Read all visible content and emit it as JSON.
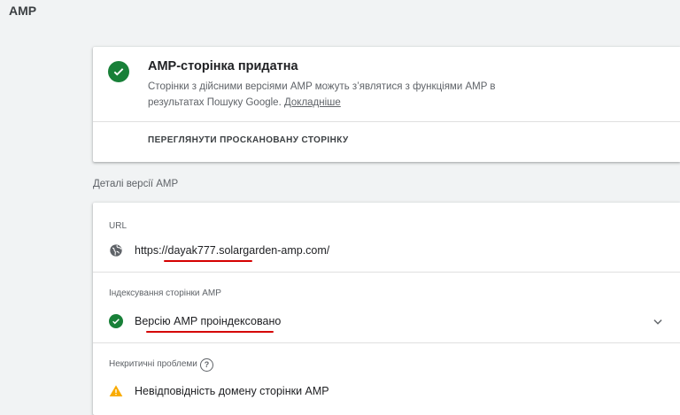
{
  "page": {
    "title": "AMP"
  },
  "status": {
    "title": "AMP-сторінка придатна",
    "description": "Сторінки з дійсними версіями AMP можуть з’являтися з функціями AMP в результатах Пошуку Google.",
    "learn_more": "Докладніше",
    "view_button": "ПЕРЕГЛЯНУТИ ПРОСКАНОВАНУ СТОРІНКУ",
    "icon": "check-circle-icon",
    "color": "#188038"
  },
  "details": {
    "section_label": "Деталі версії AMP",
    "url_label": "URL",
    "url_value": "https://dayak777.solargarden-amp.com/",
    "indexing_label": "Індексування сторінки AMP",
    "indexing_value": "Версію AMP проіндексовано",
    "noncritical_label": "Некритичні проблеми",
    "help_glyph": "?",
    "warning_value": "Невідповідність домену сторінки AMP",
    "warning_color": "#f9ab00",
    "annotation_color": "#d50000"
  }
}
